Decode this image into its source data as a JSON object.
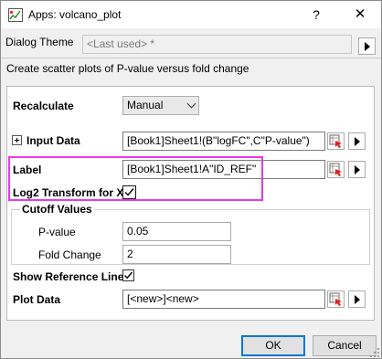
{
  "window": {
    "title": "Apps: volcano_plot",
    "help_label": "?",
    "close_label": "✕"
  },
  "dialog_theme": {
    "label": "Dialog Theme",
    "value": "<Last used> *"
  },
  "description": "Create scatter plots of P-value versus fold change",
  "form": {
    "recalculate": {
      "label": "Recalculate",
      "value": "Manual"
    },
    "input_data": {
      "label": "Input Data",
      "value": "[Book1]Sheet1!(B\"logFC\",C\"P-value\")"
    },
    "label_field": {
      "label": "Label",
      "value": "[Book1]Sheet1!A\"ID_REF\""
    },
    "log2_transform": {
      "label": "Log2 Transform for X",
      "checked": true
    },
    "cutoff": {
      "title": "Cutoff Values",
      "pvalue": {
        "label": "P-value",
        "value": "0.05"
      },
      "fold_change": {
        "label": "Fold Change",
        "value": "2"
      }
    },
    "show_reference_lines": {
      "label": "Show Reference Lines",
      "checked": true
    },
    "plot_data": {
      "label": "Plot Data",
      "value": "[<new>]<new>"
    }
  },
  "buttons": {
    "ok": "OK",
    "cancel": "Cancel"
  },
  "colors": {
    "highlight": "#e63be6",
    "primary_border": "#0078d7"
  }
}
